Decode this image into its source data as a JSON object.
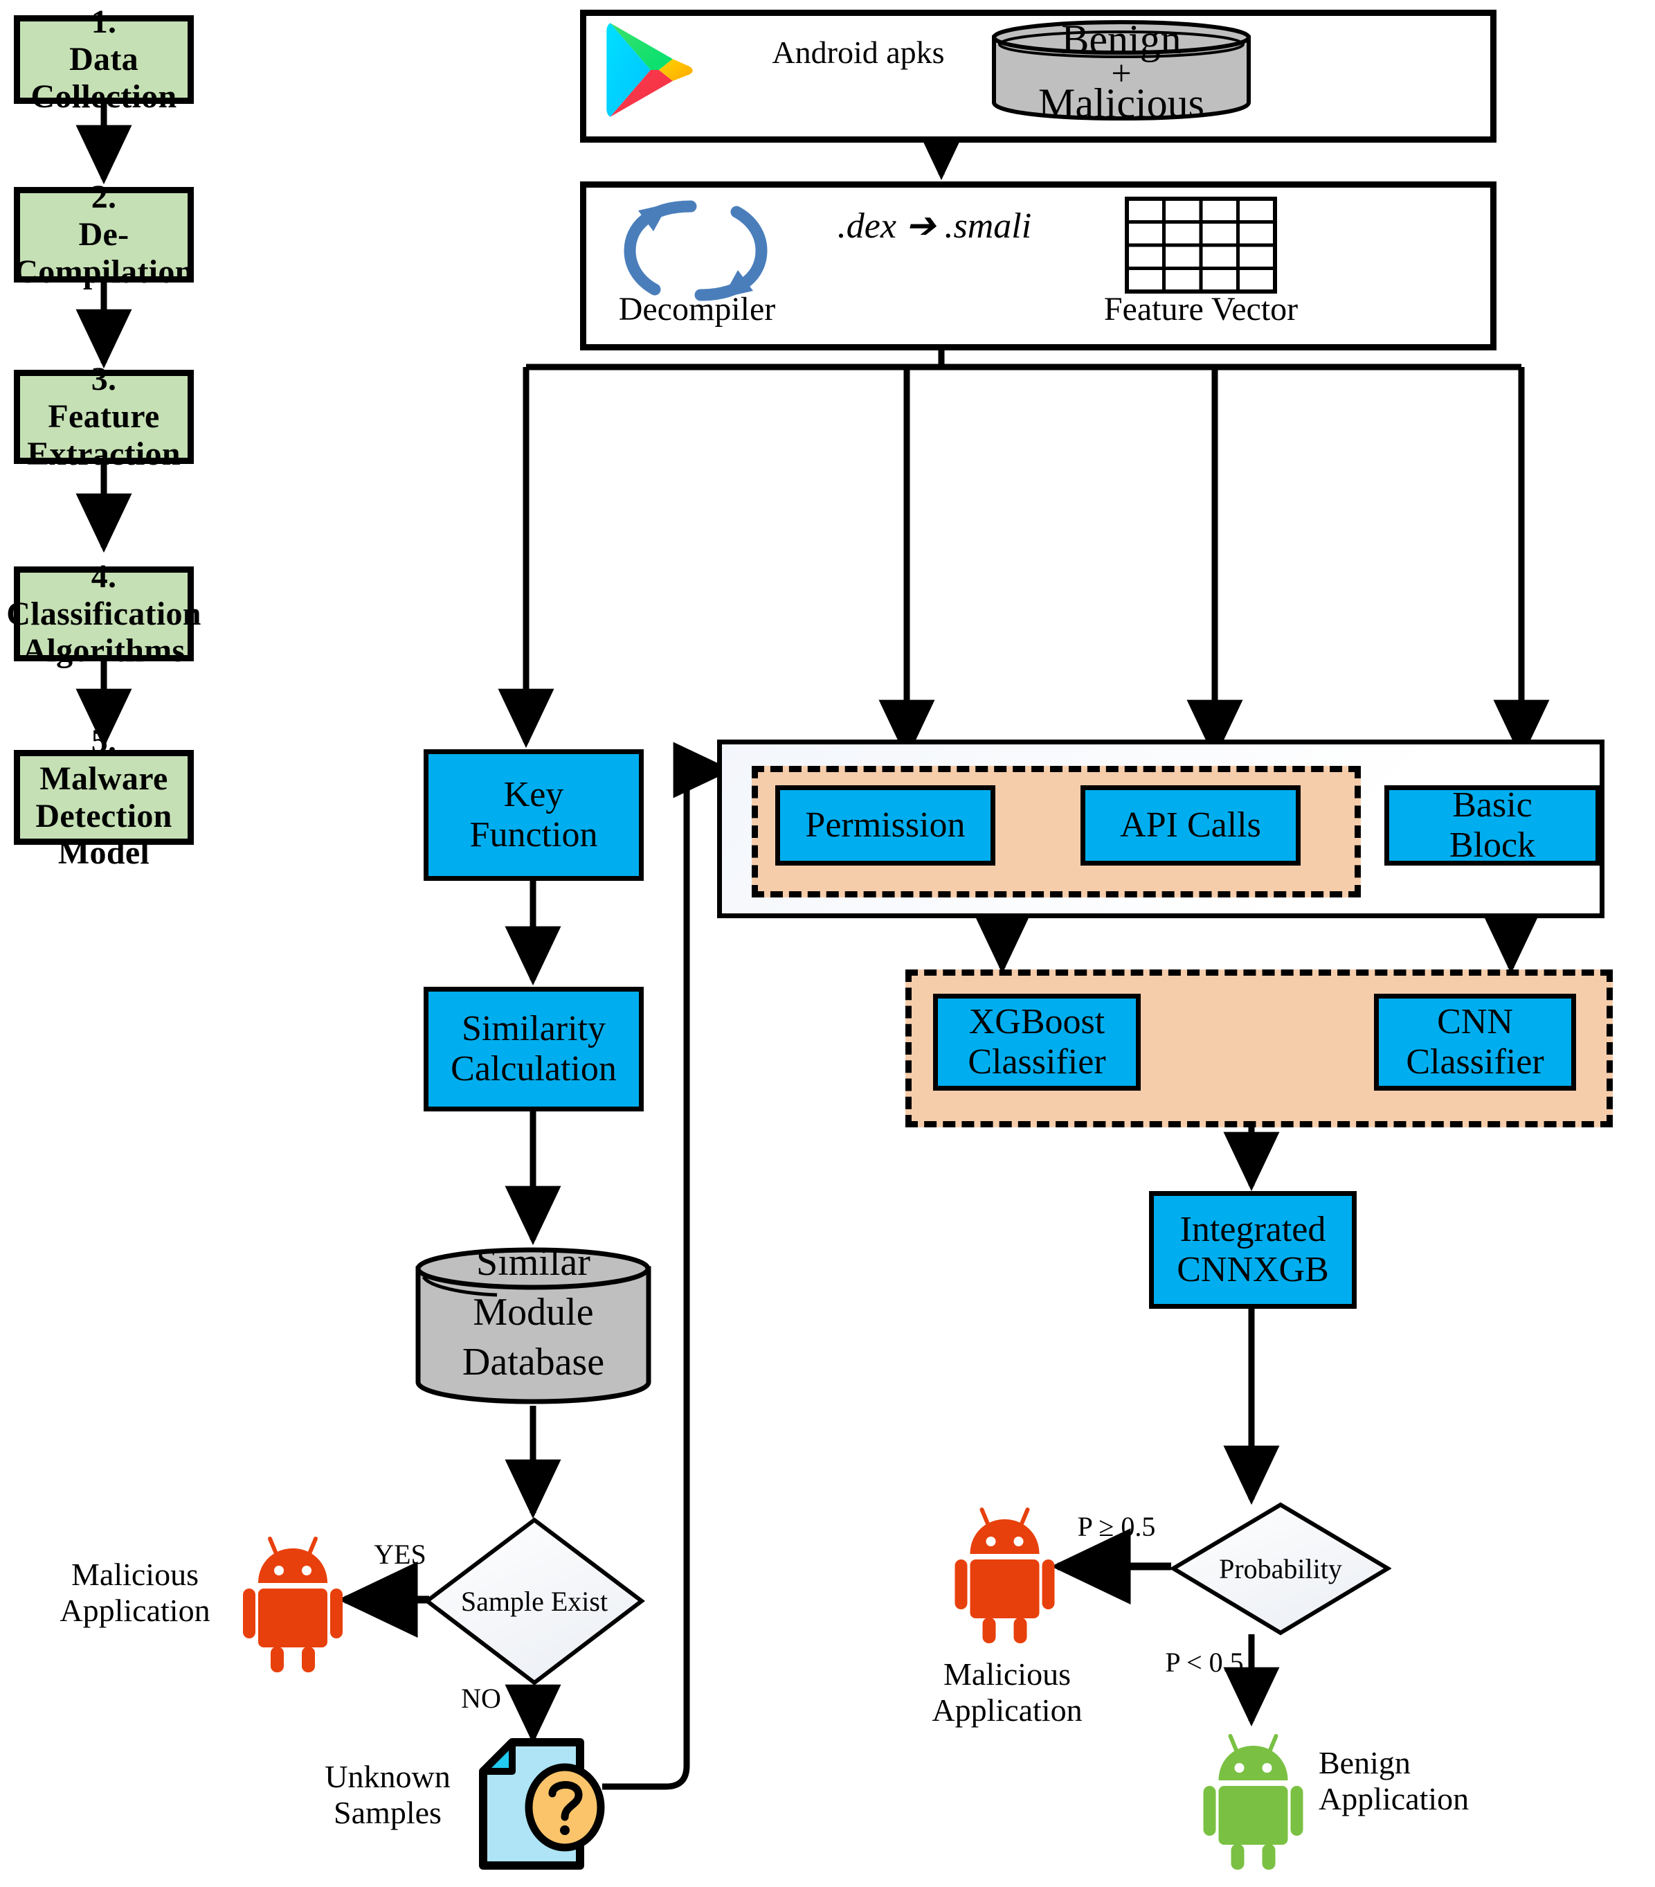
{
  "pipeline_stages": [
    {
      "num": "1.",
      "label": "Data Collection"
    },
    {
      "num": "2.",
      "label": "De-Compilation"
    },
    {
      "num": "3.",
      "label": "Feature\nExtraction"
    },
    {
      "num": "4.",
      "label": "Classification\nAlgorithms"
    },
    {
      "num": "5.",
      "label": "Malware\nDetection Model"
    }
  ],
  "stage_text": {
    "s1": "1.\nData Collection",
    "s2": "2.\nDe-Compilation",
    "s3": "3.\nFeature\nExtraction",
    "s4": "4.\nClassification\nAlgorithms",
    "s5": "5.\nMalware\nDetection Model"
  },
  "data_collection": {
    "source_icon": "google-play-icon",
    "edge_label": "Android apks",
    "database_label": "Benign\n+\nMalicious",
    "db_line1": "Benign",
    "db_plus": "+",
    "db_line2": "Malicious"
  },
  "decompilation": {
    "decompiler_icon": "circular-arrows-icon",
    "decompiler_label": "Decompiler",
    "edge_label": ".dex ➔ .smali",
    "feature_vector_label": "Feature Vector",
    "feature_vector_rows": 4,
    "feature_vector_cols": 4
  },
  "feature_extraction": {
    "key_function": "Key\nFunction",
    "permission": "Permission",
    "api_calls": "API Calls",
    "basic_block": "Basic\nBlock",
    "similarity_calculation": "Similarity\nCalculation",
    "similar_module_database": "Similar\nModule\nDatabase",
    "smdb_line1": "Similar",
    "smdb_line2": "Module",
    "smdb_line3": "Database"
  },
  "classification": {
    "xgboost": "XGBoost\nClassifier",
    "cnn": "CNN\nClassifier",
    "integrated": "Integrated\nCNNXGB"
  },
  "decisions": {
    "sample_exist": "Sample Exist",
    "sample_exist_yes": "YES",
    "sample_exist_no": "NO",
    "probability": "Probability",
    "prob_high": "P ≥ 0.5",
    "prob_low": "P < 0.5"
  },
  "outcomes": {
    "malicious_left": "Malicious\nApplication",
    "malicious_right": "Malicious\nApplication",
    "benign": "Benign\nApplication",
    "unknown_samples": "Unknown\nSamples"
  },
  "colors": {
    "stage_green": "#c5e0b4",
    "feature_blue": "#00aeef",
    "group_peach": "#f6cdab",
    "database_gray": "#bfbfbf",
    "malicious_red": "#e8400c",
    "benign_green": "#7ac143",
    "document_blue": "#aee4f5",
    "question_orange": "#fbc46a",
    "decompiler_blue": "#4a7ebb",
    "outline_black": "#000000"
  }
}
